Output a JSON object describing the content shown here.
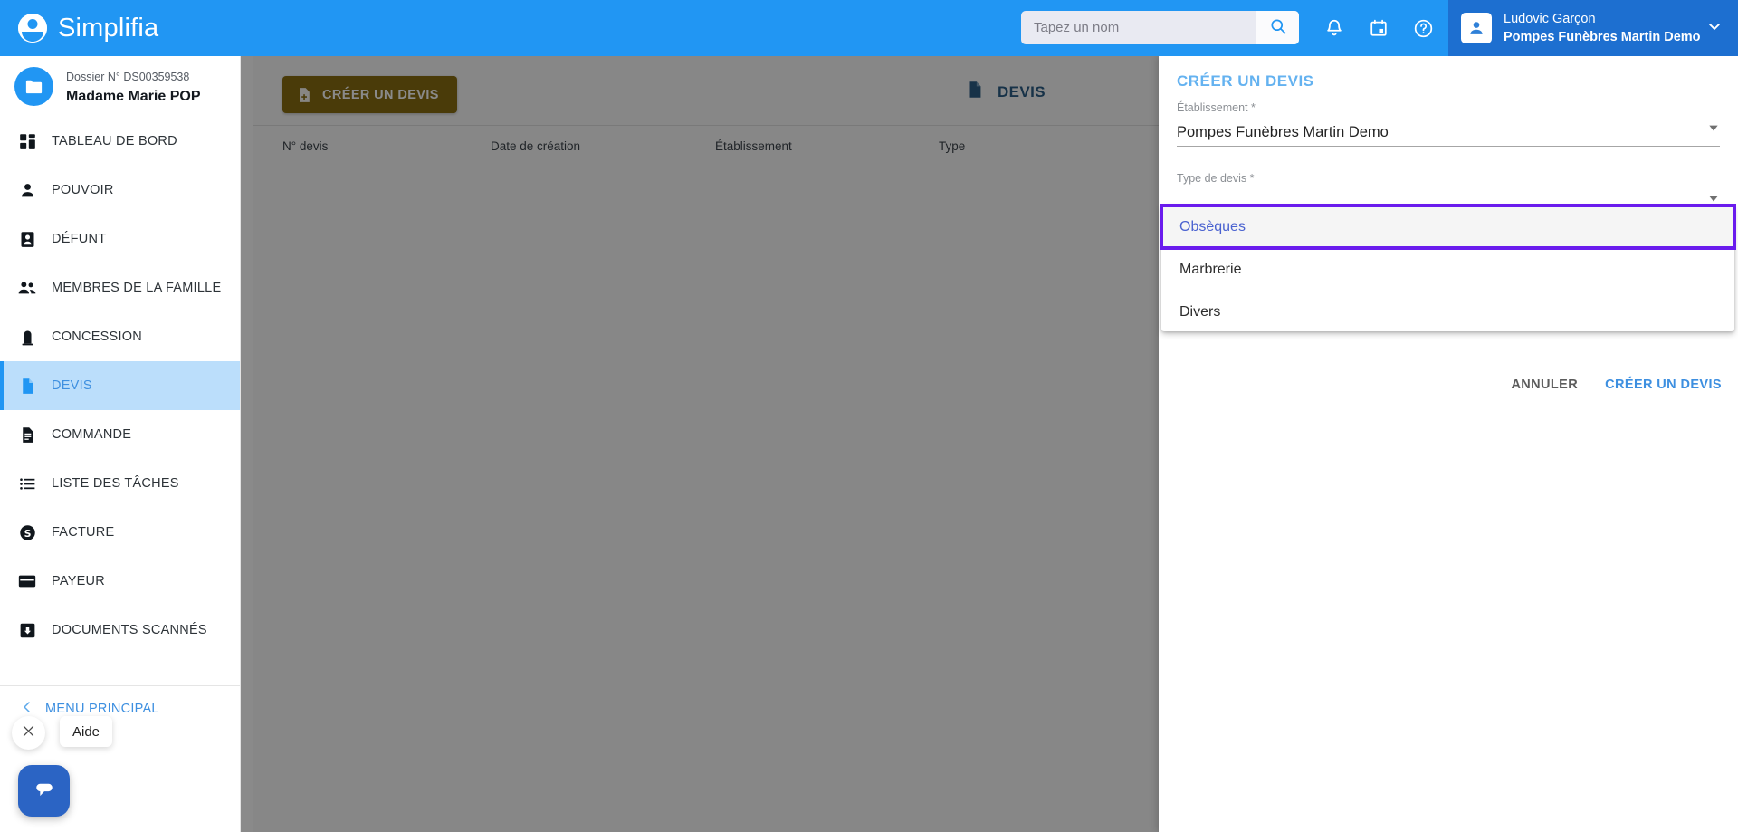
{
  "app": {
    "brand_name": "Simplifia",
    "brand_logo_icon": "simplifia-logo-icon"
  },
  "header": {
    "search": {
      "placeholder": "Tapez un nom",
      "value": "",
      "icon": "search-icon"
    },
    "icons": [
      {
        "name": "notifications-bell-icon",
        "label": "Notifications"
      },
      {
        "name": "calendar-icon",
        "label": "Agenda"
      },
      {
        "name": "help-circle-icon",
        "label": "Aide"
      }
    ],
    "user": {
      "avatar_icon": "user-avatar-icon",
      "name": "Ludovic Garçon",
      "organization": "Pompes Funèbres Martin Demo",
      "caret_icon": "chevron-down-icon"
    }
  },
  "sidebar": {
    "dossier": {
      "icon": "folder-icon",
      "number_label": "Dossier N° DS00359538",
      "person_name": "Madame Marie POP"
    },
    "items": [
      {
        "label": "TABLEAU DE BORD",
        "icon": "dashboard-icon",
        "active": false
      },
      {
        "label": "POUVOIR",
        "icon": "person-icon",
        "active": false
      },
      {
        "label": "DÉFUNT",
        "icon": "badge-person-icon",
        "active": false
      },
      {
        "label": "MEMBRES DE LA FAMILLE",
        "icon": "people-group-icon",
        "active": false
      },
      {
        "label": "CONCESSION",
        "icon": "headstone-icon",
        "active": false
      },
      {
        "label": "DEVIS",
        "icon": "document-icon",
        "active": true
      },
      {
        "label": "COMMANDE",
        "icon": "document-lines-icon",
        "active": false
      },
      {
        "label": "LISTE DES TÂCHES",
        "icon": "list-icon",
        "active": false
      },
      {
        "label": "FACTURE",
        "icon": "dollar-coin-icon",
        "active": false
      },
      {
        "label": "PAYEUR",
        "icon": "credit-card-icon",
        "active": false
      },
      {
        "label": "DOCUMENTS SCANNÉS",
        "icon": "scanned-docs-icon",
        "active": false
      }
    ],
    "menu_principal": {
      "label": "MENU PRINCIPAL",
      "icon": "chevron-left-icon"
    }
  },
  "main": {
    "create_button": {
      "label": "CRÉER UN DEVIS",
      "icon": "add-document-icon",
      "color": "#8a6d12"
    },
    "page_title": {
      "label": "DEVIS",
      "icon": "document-icon",
      "color": "#2b5d85"
    },
    "table": {
      "columns": [
        "N° devis",
        "Date de création",
        "Établissement",
        "Type"
      ],
      "rows": []
    }
  },
  "panel": {
    "title": "CRÉER UN DEVIS",
    "title_color": "#64b2f0",
    "fields": [
      {
        "label": "Établissement *",
        "value": "Pompes Funèbres Martin Demo",
        "required": true,
        "required_red": false,
        "caret_icon": "chevron-down-icon"
      },
      {
        "label": "Type de devis *",
        "value": "",
        "required": true,
        "required_red": true,
        "caret_icon": "chevron-down-icon"
      }
    ],
    "actions": {
      "cancel_label": "ANNULER",
      "submit_label": "CRÉER UN DEVIS"
    }
  },
  "dropdown": {
    "highlight_color": "#6a1bed",
    "options": [
      {
        "label": "Obsèques",
        "highlighted": true
      },
      {
        "label": "Marbrerie",
        "highlighted": false
      },
      {
        "label": "Divers",
        "highlighted": false
      }
    ]
  },
  "chat_widget": {
    "close_icon": "close-x-icon",
    "tooltip_label": "Aide",
    "fab_icon": "chat-bubble-icon",
    "fab_color": "#2b64c4"
  }
}
